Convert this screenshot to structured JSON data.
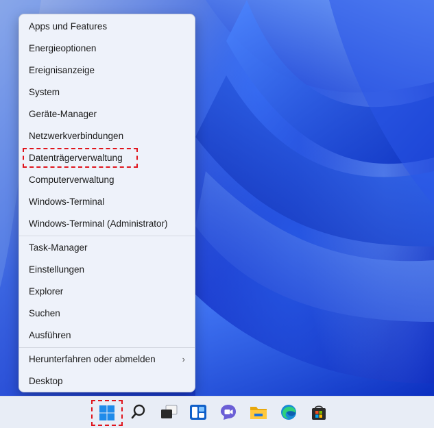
{
  "menu": {
    "items": [
      {
        "label": "Apps und Features"
      },
      {
        "label": "Energieoptionen"
      },
      {
        "label": "Ereignisanzeige"
      },
      {
        "label": "System"
      },
      {
        "label": "Geräte-Manager"
      },
      {
        "label": "Netzwerkverbindungen"
      },
      {
        "label": "Datenträgerverwaltung"
      },
      {
        "label": "Computerverwaltung"
      },
      {
        "label": "Windows-Terminal"
      },
      {
        "label": "Windows-Terminal (Administrator)"
      },
      {
        "label": "Task-Manager"
      },
      {
        "label": "Einstellungen"
      },
      {
        "label": "Explorer"
      },
      {
        "label": "Suchen"
      },
      {
        "label": "Ausführen"
      },
      {
        "label": "Herunterfahren oder abmelden",
        "submenu": true
      },
      {
        "label": "Desktop"
      }
    ],
    "submenu_chevron": "›"
  },
  "taskbar": {
    "icons": [
      {
        "name": "start-icon"
      },
      {
        "name": "search-icon"
      },
      {
        "name": "task-view-icon"
      },
      {
        "name": "widgets-icon"
      },
      {
        "name": "teams-chat-icon"
      },
      {
        "name": "file-explorer-icon"
      },
      {
        "name": "edge-icon"
      },
      {
        "name": "store-icon"
      }
    ]
  },
  "colors": {
    "highlight": "#e0141c",
    "menu_bg": "#eef2fa",
    "taskbar_bg": "#e8edf6"
  }
}
